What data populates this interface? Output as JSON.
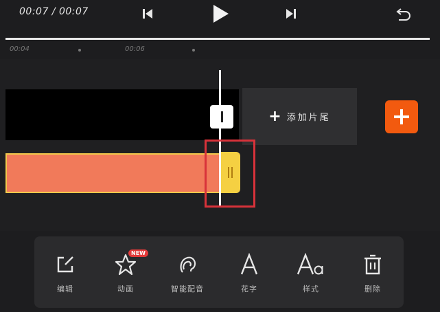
{
  "playback": {
    "time": "00:07 / 00:07"
  },
  "ruler": {
    "labels": [
      "00:04",
      "00:06"
    ]
  },
  "track": {
    "add_tail_label": "添加片尾",
    "add_tail_icon": "plus-icon"
  },
  "toolbar": {
    "items": [
      {
        "label": "编辑",
        "icon": "edit-icon"
      },
      {
        "label": "动画",
        "icon": "star-icon",
        "badge": "NEW"
      },
      {
        "label": "智能配音",
        "icon": "voice-icon"
      },
      {
        "label": "花字",
        "icon": "text-a-icon"
      },
      {
        "label": "样式",
        "icon": "text-style-icon"
      },
      {
        "label": "删除",
        "icon": "trash-icon"
      }
    ]
  },
  "colors": {
    "accent": "#f25a0f",
    "text_clip": "#f17a5a",
    "handle": "#f5d042",
    "highlight": "#d8323a"
  }
}
